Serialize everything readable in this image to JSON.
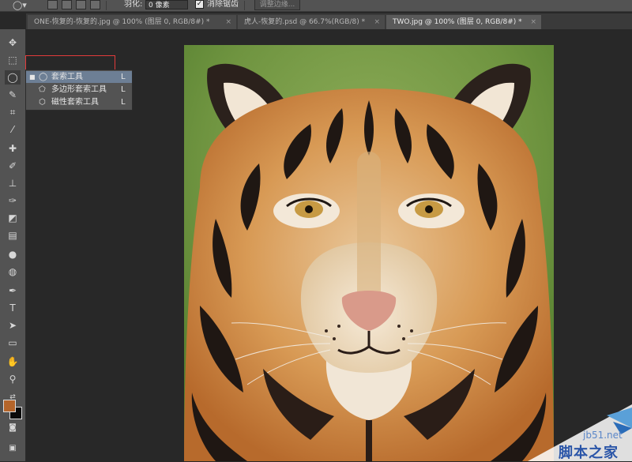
{
  "options_bar": {
    "feather_label": "羽化:",
    "feather_value": "0 像素",
    "anti_alias_label": "消除锯齿",
    "anti_alias_checked": "✓",
    "refine_edge_label": "调整边缘..."
  },
  "tabs": [
    {
      "label": "ONE-恢复的-恢复的.jpg @ 100% (图层 0, RGB/8#) *",
      "close": "×"
    },
    {
      "label": "虎人-恢复的.psd @ 66.7%(RGB/8) *",
      "close": "×"
    },
    {
      "label": "TWO.jpg @ 100% (图层 0, RGB/8#) *",
      "close": "×"
    }
  ],
  "flyout": {
    "items": [
      {
        "bullet": "■",
        "name": "套索工具",
        "key": "L"
      },
      {
        "bullet": "",
        "name": "多边形套索工具",
        "key": "L"
      },
      {
        "bullet": "",
        "name": "磁性套索工具",
        "key": "L"
      }
    ]
  },
  "tools": [
    {
      "icon": "move-icon",
      "glyph": "✥"
    },
    {
      "icon": "marquee-icon",
      "glyph": "⬚"
    },
    {
      "icon": "lasso-icon",
      "glyph": "◯"
    },
    {
      "icon": "quick-select-icon",
      "glyph": "✎"
    },
    {
      "icon": "crop-icon",
      "glyph": "⌗"
    },
    {
      "icon": "eyedropper-icon",
      "glyph": "⁄"
    },
    {
      "icon": "healing-icon",
      "glyph": "✚"
    },
    {
      "icon": "brush-icon",
      "glyph": "✐"
    },
    {
      "icon": "stamp-icon",
      "glyph": "⊥"
    },
    {
      "icon": "history-brush-icon",
      "glyph": "✑"
    },
    {
      "icon": "eraser-icon",
      "glyph": "◩"
    },
    {
      "icon": "gradient-icon",
      "glyph": "▤"
    },
    {
      "icon": "blur-icon",
      "glyph": "●"
    },
    {
      "icon": "dodge-icon",
      "glyph": "◍"
    },
    {
      "icon": "pen-icon",
      "glyph": "✒"
    },
    {
      "icon": "type-icon",
      "glyph": "T"
    },
    {
      "icon": "path-select-icon",
      "glyph": "➤"
    },
    {
      "icon": "shape-icon",
      "glyph": "▭"
    },
    {
      "icon": "hand-icon",
      "glyph": "✋"
    },
    {
      "icon": "zoom-icon",
      "glyph": "⚲"
    }
  ],
  "colors": {
    "foreground": "#b5652a",
    "background": "#0a0a0a",
    "highlight": "#e23b3b"
  },
  "watermark": {
    "site": "jb51.net",
    "name": "脚本之家"
  }
}
